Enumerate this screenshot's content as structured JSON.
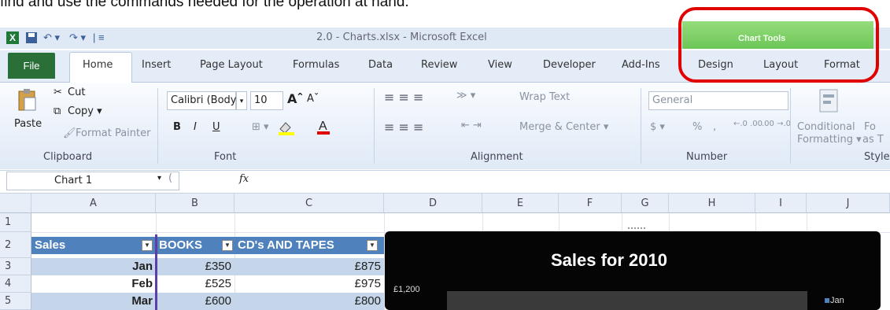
{
  "caption": "find and use the commands needed for the operation at hand.",
  "window": {
    "title": "2.0 - Charts.xlsx - Microsoft Excel",
    "app_icon": "X"
  },
  "quick_access": {
    "undo": "↶ ▾",
    "redo": "↷ ▾",
    "customize": "| ≡"
  },
  "chart_tools": {
    "label": "Chart Tools",
    "tabs": [
      "Design",
      "Layout",
      "Format"
    ]
  },
  "tabs": [
    "File",
    "Home",
    "Insert",
    "Page Layout",
    "Formulas",
    "Data",
    "Review",
    "View",
    "Developer",
    "Add-Ins"
  ],
  "clipboard": {
    "paste": "Paste",
    "cut": "Cut",
    "copy": "Copy ▾",
    "format_painter": "Format Painter",
    "label": "Clipboard"
  },
  "font": {
    "name": "Calibri (Body)",
    "size": "10",
    "grow": "Aˆ",
    "shrink": "Aˇ",
    "bold": "B",
    "italic": "I",
    "underline": "U",
    "label": "Font"
  },
  "alignment": {
    "wrap": "Wrap Text",
    "merge": "Merge & Center ▾",
    "label": "Alignment"
  },
  "number": {
    "format": "General",
    "percent": "%",
    "comma": ",",
    "inc": "←.0 .00",
    "dec": ".00 →.0",
    "label": "Number"
  },
  "styles": {
    "conditional": "Conditional",
    "formatting": "Formatting ▾",
    "format_as": "Fo",
    "as_table": "as T",
    "label": "Style"
  },
  "formula_bar": {
    "name_box": "Chart 1",
    "fx": "fx",
    "content": ""
  },
  "columns": [
    "A",
    "B",
    "C",
    "D",
    "E",
    "F",
    "G",
    "H",
    "I",
    "J"
  ],
  "rows": [
    "1",
    "2",
    "3",
    "4",
    "5"
  ],
  "table": {
    "headers": [
      "Sales",
      "BOOKS",
      "CD's AND TAPES"
    ],
    "rows": [
      [
        "Jan",
        "£350",
        "£875"
      ],
      [
        "Feb",
        "£525",
        "£975"
      ],
      [
        "Mar",
        "£600",
        "£800"
      ]
    ]
  },
  "chart": {
    "title": "Sales for 2010",
    "y_tick_top": "£1,200",
    "legend_first": "Jan",
    "colors": {
      "background": "#050505",
      "series": "#4f81bd"
    }
  },
  "colors": {
    "highlight_box": "#e00000",
    "chart_tools": "#6cc657",
    "file_tab": "#2a6f38",
    "table_header": "#4f81bd"
  }
}
